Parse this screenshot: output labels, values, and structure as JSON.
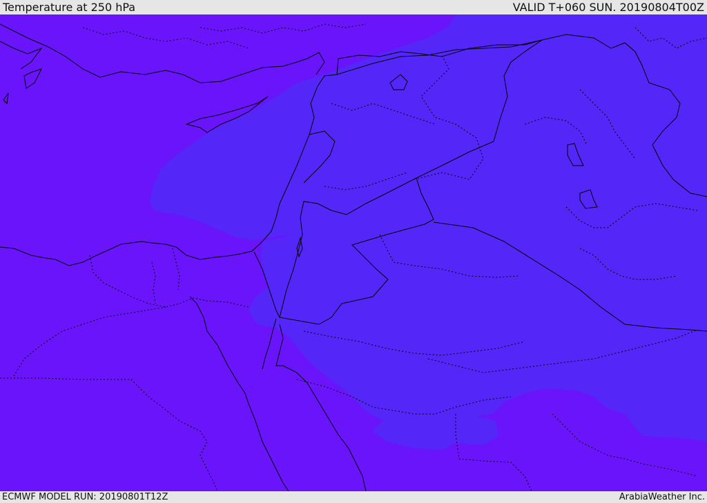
{
  "header": {
    "title": "Temperature at 250 hPa",
    "valid": "VALID T+060 SUN. 20190804T00Z"
  },
  "footer": {
    "model_run": "ECMWF MODEL RUN: 20190801T12Z",
    "credit": "ArabiaWeather Inc."
  },
  "map": {
    "colors": {
      "cold_fill": "#6a14fb",
      "warm_fill": "#5426f7",
      "coastline": "#000000",
      "border": "#000000"
    }
  }
}
